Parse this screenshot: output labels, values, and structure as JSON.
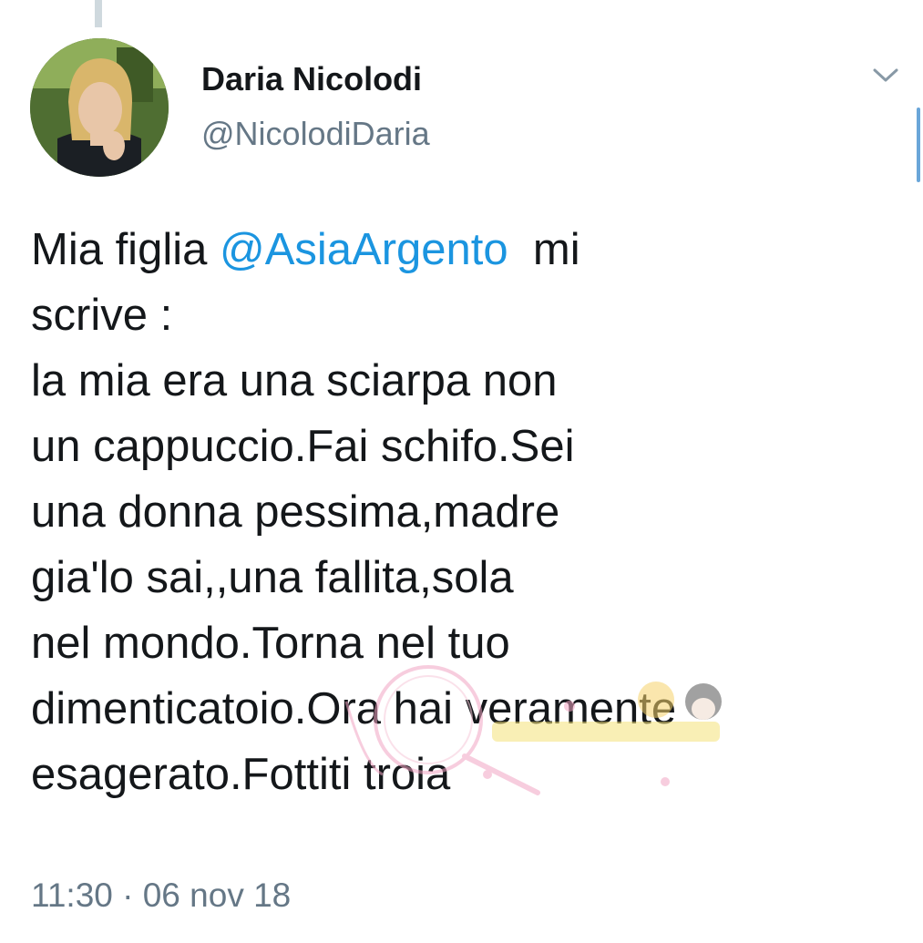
{
  "tweet": {
    "author": {
      "name": "Daria Nicolodi",
      "handle": "@NicolodiDaria",
      "avatar_icon": "profile-photo"
    },
    "menu_icon": "chevron-down-icon",
    "body": {
      "line1": {
        "before": "Mia figlia ",
        "mention": "@AsiaArgento",
        "after": "  mi"
      },
      "line2": "scrive :",
      "line3": "la mia era una sciarpa non",
      "line4": "un cappuccio.Fai schifo.Sei",
      "line5": "una donna pessima,madre",
      "line6": "gia'lo sai,,una fallita,sola",
      "line7": "nel mondo.Torna nel tuo",
      "line8": "dimenticatoio.Ora hai veramente",
      "line9": "esagerato.Fottiti troia"
    },
    "timestamp": "11:30 · 06 nov 18"
  },
  "colors": {
    "text": "#14171a",
    "secondary": "#657786",
    "link": "#1b95e0",
    "background": "#ffffff"
  }
}
